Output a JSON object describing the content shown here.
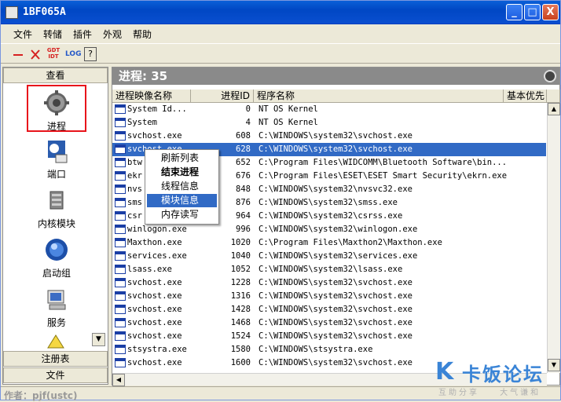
{
  "window": {
    "title": "1BF065A",
    "min": "_",
    "max": "□",
    "close": "X"
  },
  "menu": [
    "文件",
    "转储",
    "插件",
    "外观",
    "帮助"
  ],
  "toolbar": {
    "gdt_label": "GDT",
    "idt_label": "IDT",
    "log_label": "LOG",
    "help_label": "?"
  },
  "sidebar": {
    "header": "查看",
    "items": [
      {
        "label": "进程",
        "icon": "gear-icon"
      },
      {
        "label": "端口",
        "icon": "network-icon"
      },
      {
        "label": "内核模块",
        "icon": "module-icon"
      },
      {
        "label": "启动组",
        "icon": "startup-icon"
      },
      {
        "label": "服务",
        "icon": "service-icon"
      }
    ],
    "footer": [
      "注册表",
      "文件"
    ]
  },
  "process_panel": {
    "title": "进程: 35",
    "columns": [
      "进程映像名称",
      "进程ID",
      "程序名称",
      "基本优先"
    ],
    "rows": [
      {
        "name": "System Id...",
        "pid": "0",
        "path": "NT OS Kernel"
      },
      {
        "name": "System",
        "pid": "4",
        "path": "NT OS Kernel"
      },
      {
        "name": "svchost.exe",
        "pid": "608",
        "path": "C:\\WINDOWS\\system32\\svchost.exe"
      },
      {
        "name": "svchost.exe",
        "pid": "628",
        "path": "C:\\WINDOWS\\system32\\svchost.exe"
      },
      {
        "name": "btw",
        "pid": "652",
        "path": "C:\\Program Files\\WIDCOMM\\Bluetooth Software\\bin..."
      },
      {
        "name": "ekr",
        "pid": "676",
        "path": "C:\\Program Files\\ESET\\ESET Smart Security\\ekrn.exe"
      },
      {
        "name": "nvs",
        "pid": "848",
        "path": "C:\\WINDOWS\\system32\\nvsvc32.exe"
      },
      {
        "name": "sms",
        "pid": "876",
        "path": "C:\\WINDOWS\\system32\\smss.exe"
      },
      {
        "name": "csr",
        "pid": "964",
        "path": "C:\\WINDOWS\\system32\\csrss.exe"
      },
      {
        "name": "winlogon.exe",
        "pid": "996",
        "path": "C:\\WINDOWS\\system32\\winlogon.exe"
      },
      {
        "name": "Maxthon.exe",
        "pid": "1020",
        "path": "C:\\Program Files\\Maxthon2\\Maxthon.exe"
      },
      {
        "name": "services.exe",
        "pid": "1040",
        "path": "C:\\WINDOWS\\system32\\services.exe"
      },
      {
        "name": "lsass.exe",
        "pid": "1052",
        "path": "C:\\WINDOWS\\system32\\lsass.exe"
      },
      {
        "name": "svchost.exe",
        "pid": "1228",
        "path": "C:\\WINDOWS\\system32\\svchost.exe"
      },
      {
        "name": "svchost.exe",
        "pid": "1316",
        "path": "C:\\WINDOWS\\system32\\svchost.exe"
      },
      {
        "name": "svchost.exe",
        "pid": "1428",
        "path": "C:\\WINDOWS\\system32\\svchost.exe"
      },
      {
        "name": "svchost.exe",
        "pid": "1468",
        "path": "C:\\WINDOWS\\system32\\svchost.exe"
      },
      {
        "name": "svchost.exe",
        "pid": "1524",
        "path": "C:\\WINDOWS\\system32\\svchost.exe"
      },
      {
        "name": "stsystra.exe",
        "pid": "1580",
        "path": "C:\\WINDOWS\\stsystra.exe"
      },
      {
        "name": "svchost.exe",
        "pid": "1600",
        "path": "C:\\WINDOWS\\system32\\svchost.exe"
      }
    ]
  },
  "context_menu": [
    "刷新列表",
    "结束进程",
    "线程信息",
    "模块信息",
    "内存读写"
  ],
  "status": {
    "text": "作者：pjf(ustc)"
  },
  "watermark": {
    "k": "K",
    "brand": "卡饭论坛",
    "slogan": "互助分享 大气谦和"
  }
}
